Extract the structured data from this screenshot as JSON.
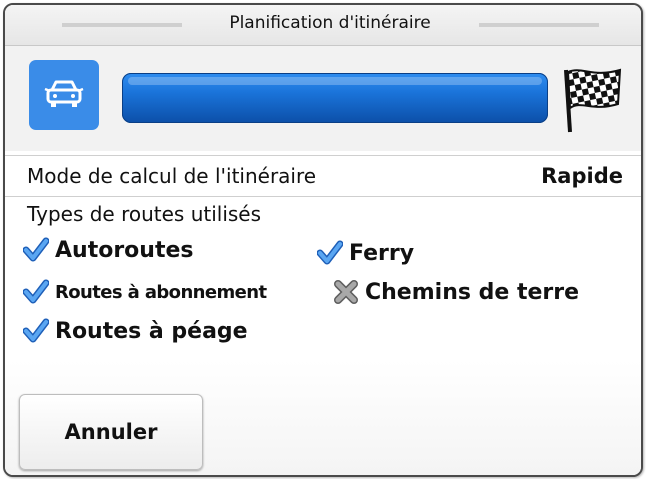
{
  "dialog": {
    "title": "Planification d'itinéraire"
  },
  "progress": {
    "vehicle_icon": "car-icon",
    "destination_icon": "checkered-flag-icon",
    "percent": 100,
    "bar_color": "#1a73d9"
  },
  "route_mode": {
    "label": "Mode de calcul de l'itinéraire",
    "value": "Rapide"
  },
  "road_types": {
    "label": "Types de routes utilisés",
    "items": [
      {
        "label": "Autoroutes",
        "enabled": true
      },
      {
        "label": "Ferry",
        "enabled": true
      },
      {
        "label": "Routes à abonnement",
        "enabled": true
      },
      {
        "label": "Chemins de terre",
        "enabled": false
      },
      {
        "label": "Routes à péage",
        "enabled": true
      }
    ]
  },
  "actions": {
    "cancel_label": "Annuler"
  },
  "colors": {
    "check": "#3d8fe8",
    "cross": "#8a8a8a",
    "accent": "#3a8ce8"
  }
}
